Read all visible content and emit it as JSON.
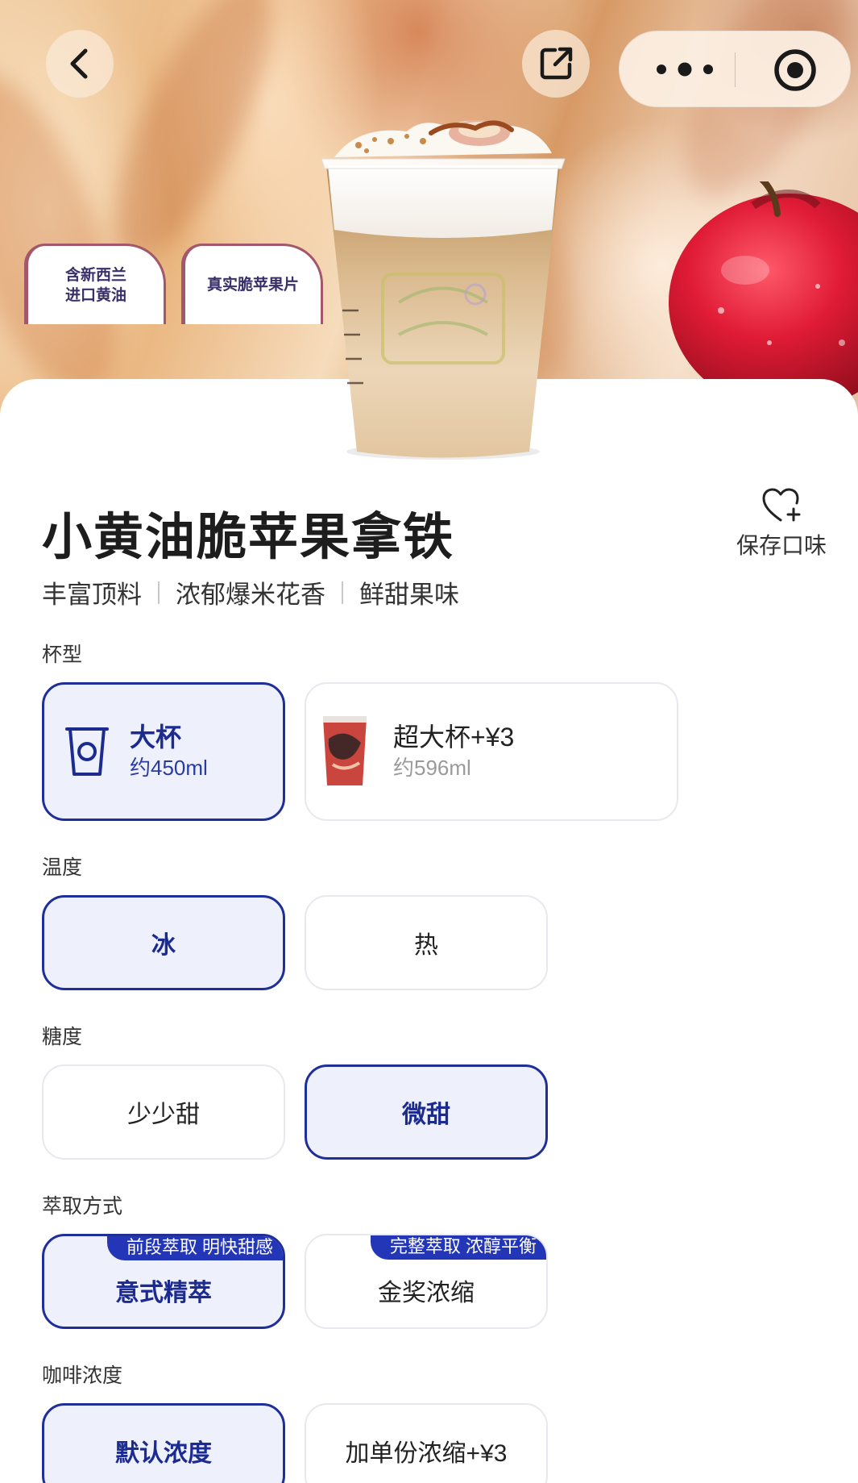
{
  "hero": {
    "tags": [
      {
        "lines": [
          "含新西兰",
          "进口黄油"
        ]
      },
      {
        "lines": [
          "真实脆苹果片"
        ]
      }
    ],
    "icons": {
      "back": "chevron-left-icon",
      "share": "share-external-icon",
      "more": "more-dots-icon",
      "close": "target-circle-icon"
    }
  },
  "product": {
    "title": "小黄油脆苹果拿铁",
    "save_label": "保存口味",
    "features": [
      "丰富顶料",
      "浓郁爆米花香",
      "鲜甜果味"
    ]
  },
  "sections": {
    "cup_size": {
      "label": "杯型",
      "options": [
        {
          "name": "大杯",
          "volume": "约450ml",
          "selected": true
        },
        {
          "name": "超大杯+¥3",
          "volume": "约596ml",
          "selected": false
        }
      ]
    },
    "temperature": {
      "label": "温度",
      "options": [
        {
          "name": "冰",
          "selected": true
        },
        {
          "name": "热",
          "selected": false
        }
      ]
    },
    "sweetness": {
      "label": "糖度",
      "options": [
        {
          "name": "少少甜",
          "selected": false
        },
        {
          "name": "微甜",
          "selected": true
        }
      ]
    },
    "extraction": {
      "label": "萃取方式",
      "options": [
        {
          "name": "意式精萃",
          "badge": "前段萃取 明快甜感",
          "selected": true
        },
        {
          "name": "金奖浓缩",
          "badge": "完整萃取 浓醇平衡",
          "selected": false
        }
      ]
    },
    "strength": {
      "label": "咖啡浓度",
      "options": [
        {
          "name": "默认浓度",
          "selected": true
        },
        {
          "name": "加单份浓缩+¥3",
          "selected": false
        }
      ]
    }
  },
  "colors": {
    "accent": "#1f2f9a",
    "selected_bg": "#eef1fc",
    "badge_bg": "#2436b8",
    "tag_border": "#a2576a"
  }
}
